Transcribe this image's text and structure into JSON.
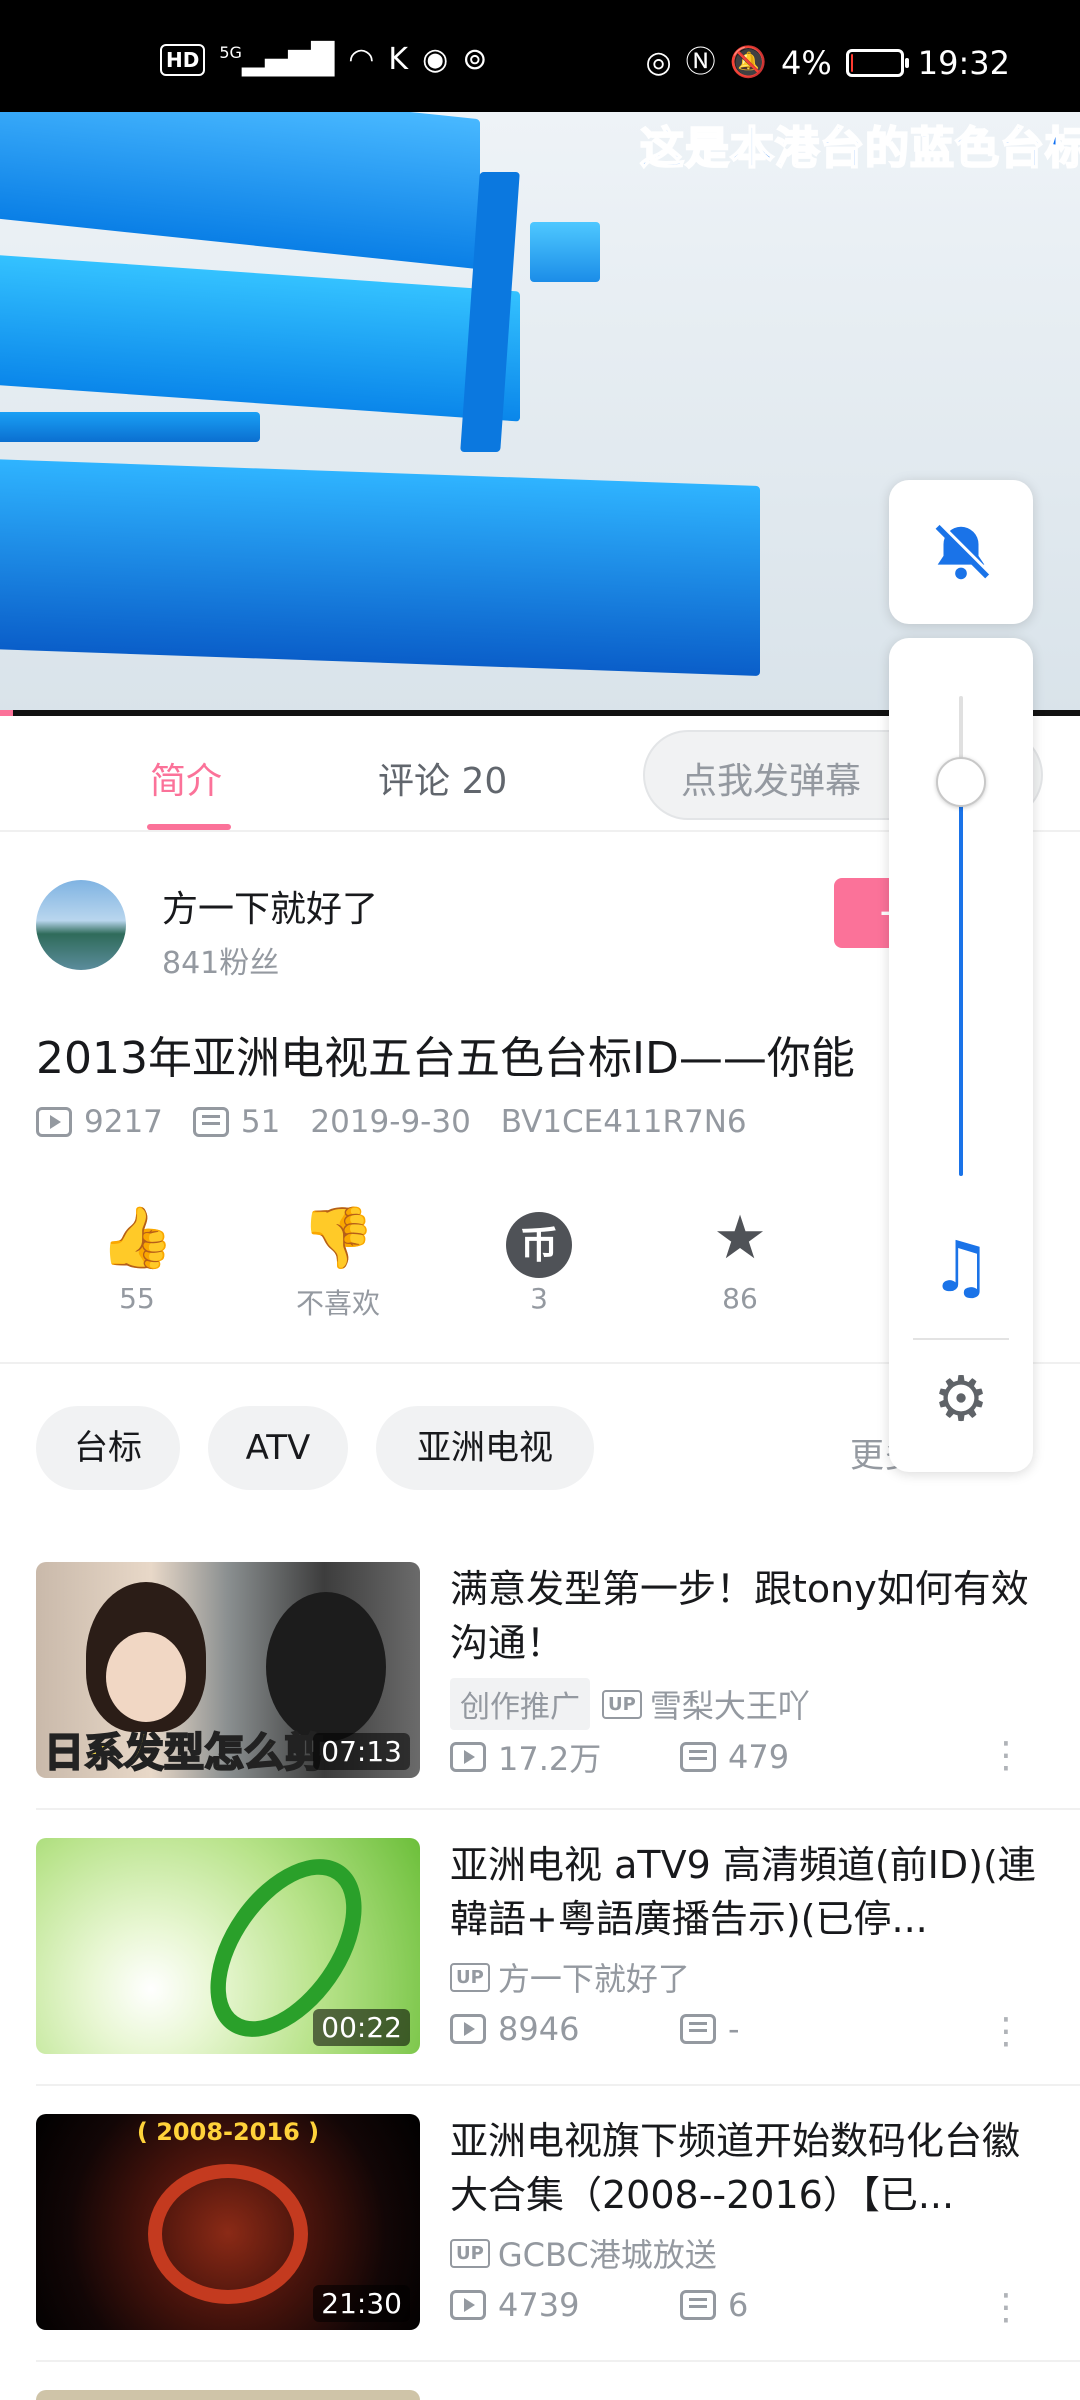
{
  "status_bar": {
    "left_icons": [
      "hd-badge",
      "5g-signal-icon",
      "wifi-icon",
      "k-icon",
      "app-icon",
      "hotspot-icon"
    ],
    "hd_label": "HD",
    "net_label": "5G",
    "battery_percent_text": "4%",
    "battery_level": 0.04,
    "time": "19:32"
  },
  "video": {
    "overlay_text": "这是本港台的蓝色台标",
    "progress": 0.012,
    "colors": {
      "accent": "#fb7299",
      "title": "#0c6ef2"
    }
  },
  "tabs": [
    {
      "label": "简介",
      "active": true
    },
    {
      "label": "评论 20",
      "active": false
    }
  ],
  "danmaku": {
    "placeholder": "点我发弹幕"
  },
  "uploader": {
    "name": "方一下就好了",
    "fans": "841粉丝",
    "follow_label": "+"
  },
  "video_info": {
    "title": "2013年亚洲电视五台五色台标ID——你能",
    "views": "9217",
    "danmaku_count": "51",
    "date": "2019-9-30",
    "bvid": "BV1CE411R7N6"
  },
  "actions": [
    {
      "icon": "thumb-up-icon",
      "label": "55"
    },
    {
      "icon": "thumb-down-icon",
      "label": "不喜欢"
    },
    {
      "icon": "coin-icon",
      "label": "3"
    },
    {
      "icon": "star-icon",
      "label": "86"
    }
  ],
  "tags": [
    "台标",
    "ATV",
    "亚洲电视"
  ],
  "more_tags_label": "更多",
  "recommendations": [
    {
      "title": "满意发型第一步！跟tony如何有效沟通！",
      "promo": "创作推广",
      "up_badge": "UP",
      "uploader": "雪梨大王吖",
      "views": "17.2万",
      "danmaku": "479",
      "duration": "07:13",
      "thumb_caption": "日系发型怎么剪"
    },
    {
      "title": "亚洲电视 aTV9 高清頻道(前ID)(連韓語+粵語廣播告示)(已停...",
      "promo": "",
      "up_badge": "UP",
      "uploader": "方一下就好了",
      "views": "8946",
      "danmaku": "-",
      "duration": "00:22",
      "thumb_caption": ""
    },
    {
      "title": "亚洲电视旗下频道开始数码化台徽大合集（2008--2016）【已...",
      "promo": "",
      "up_badge": "UP",
      "uploader": "GCBC港城放送",
      "views": "4739",
      "danmaku": "6",
      "duration": "21:30",
      "thumb_caption": "( 2008-2016 )"
    }
  ],
  "volume_panel": {
    "level": 0.82,
    "bell_icon": "bell-muted-icon",
    "mode_icon": "music-note-icon",
    "settings_icon": "gear-icon"
  }
}
